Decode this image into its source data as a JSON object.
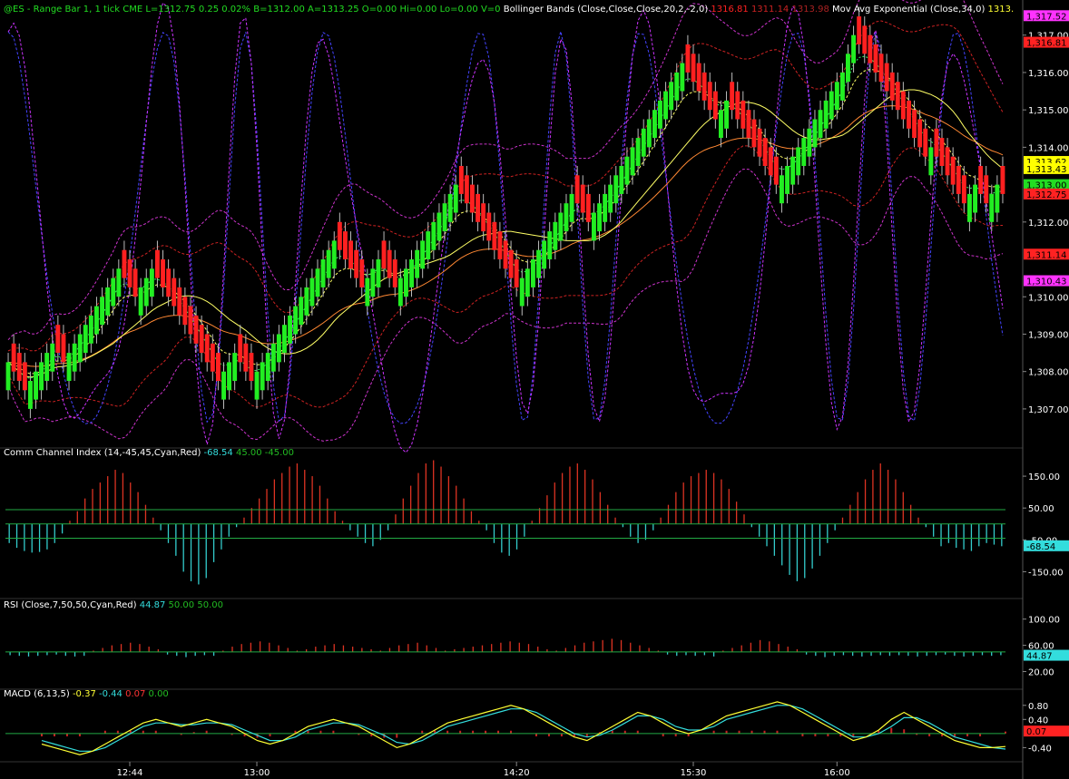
{
  "chart_data": [
    {
      "type": "candlestick",
      "title": "@ES - Range Bar 1, 1 tick  CME",
      "header_values": [
        "L=1312.75",
        "0.25",
        "0.02%",
        "B=1312.00",
        "A=1313.25",
        "O=0.00",
        "Hi=0.00",
        "Lo=0.00",
        "V=0"
      ],
      "indicators": [
        {
          "name": "Bollinger Bands (Close,Close,Close,20,2,-2,0)",
          "values": [
            "1316.81",
            "1311.14",
            "1313.98"
          ]
        },
        {
          "name": "Mov Avg Exponential (Close,34,0)",
          "values": [
            "1313."
          ]
        }
      ],
      "ylim": [
        1306.1,
        1317.6
      ],
      "y_ticks": [
        "1,317.00",
        "1,316.00",
        "1,315.00",
        "1,314.00",
        "1,312.00",
        "1,310.00",
        "1,309.00",
        "1,308.00",
        "1,307.00"
      ],
      "y_markers": [
        {
          "label": "1,317.52",
          "value": 1317.52,
          "color": "#ff33ff"
        },
        {
          "label": "1,316.81",
          "value": 1316.81,
          "color": "#ff2222"
        },
        {
          "label": "1,313.62",
          "value": 1313.62,
          "color": "#ffff00"
        },
        {
          "label": "1,313.43",
          "value": 1313.43,
          "color": "#ffff00"
        },
        {
          "label": "1,313.00",
          "value": 1313.0,
          "color": "#22dd22"
        },
        {
          "label": "1,312.75",
          "value": 1312.75,
          "color": "#ff2222"
        },
        {
          "label": "1,311.14",
          "value": 1311.14,
          "color": "#ff2222"
        },
        {
          "label": "1,310.43",
          "value": 1310.43,
          "color": "#ff33ff"
        }
      ],
      "closes": [
        1308.25,
        1308.0,
        1307.75,
        1307.5,
        1307.75,
        1308.0,
        1308.25,
        1308.5,
        1308.75,
        1308.5,
        1308.25,
        1308.5,
        1308.75,
        1309.0,
        1309.25,
        1309.5,
        1309.75,
        1310.0,
        1310.25,
        1310.5,
        1310.75,
        1310.5,
        1310.25,
        1310.0,
        1310.25,
        1310.5,
        1310.75,
        1310.5,
        1310.25,
        1310.0,
        1309.75,
        1309.5,
        1309.25,
        1309.0,
        1308.75,
        1308.5,
        1308.25,
        1308.0,
        1307.75,
        1308.0,
        1308.25,
        1308.5,
        1308.25,
        1308.0,
        1307.75,
        1308.0,
        1308.25,
        1308.5,
        1308.75,
        1309.0,
        1309.25,
        1309.5,
        1309.75,
        1310.0,
        1310.25,
        1310.5,
        1310.75,
        1311.0,
        1311.25,
        1311.5,
        1311.25,
        1311.0,
        1310.75,
        1310.5,
        1310.25,
        1310.5,
        1310.75,
        1311.0,
        1310.75,
        1310.5,
        1310.25,
        1310.5,
        1310.75,
        1311.0,
        1311.25,
        1311.5,
        1311.75,
        1312.0,
        1312.25,
        1312.5,
        1312.75,
        1313.0,
        1312.75,
        1312.5,
        1312.25,
        1312.0,
        1311.75,
        1311.5,
        1311.25,
        1311.0,
        1310.75,
        1310.5,
        1310.25,
        1310.5,
        1310.75,
        1311.0,
        1311.25,
        1311.5,
        1311.75,
        1312.0,
        1312.25,
        1312.5,
        1312.75,
        1312.5,
        1312.25,
        1312.0,
        1312.25,
        1312.5,
        1312.75,
        1313.0,
        1313.25,
        1313.5,
        1313.75,
        1314.0,
        1314.25,
        1314.5,
        1314.75,
        1315.0,
        1315.25,
        1315.5,
        1315.75,
        1316.0,
        1316.25,
        1316.0,
        1315.75,
        1315.5,
        1315.25,
        1315.0,
        1314.75,
        1315.0,
        1315.25,
        1315.0,
        1314.75,
        1314.5,
        1314.25,
        1314.0,
        1313.75,
        1313.5,
        1313.25,
        1313.0,
        1313.25,
        1313.5,
        1313.75,
        1314.0,
        1314.25,
        1314.5,
        1314.75,
        1315.0,
        1315.25,
        1315.5,
        1315.75,
        1316.0,
        1316.5,
        1317.0,
        1316.75,
        1316.5,
        1316.25,
        1316.0,
        1315.75,
        1315.5,
        1315.25,
        1315.0,
        1314.75,
        1314.5,
        1314.25,
        1314.0,
        1313.75,
        1314.0,
        1313.75,
        1313.5,
        1313.25,
        1313.0,
        1312.75,
        1312.5,
        1312.75,
        1313.0,
        1312.75,
        1312.5,
        1312.75,
        1313.0,
        1312.75
      ],
      "x_ticks": [
        "12:44",
        "13:00",
        "14:20",
        "15:30",
        "16:00"
      ],
      "x_tick_bars": [
        22,
        45,
        92,
        124,
        150
      ]
    },
    {
      "type": "bar",
      "title": "Comm Channel Index (14,-45,45,Cyan,Red)",
      "legend_values": [
        {
          "text": "-68.54",
          "color": "#33dddd"
        },
        {
          "text": "45.00",
          "color": "#22bb22"
        },
        {
          "text": "-45.00",
          "color": "#22bb22"
        }
      ],
      "ylim": [
        -220,
        210
      ],
      "y_ticks": [
        "150.00",
        "50.00",
        "-50.00",
        "-150.00"
      ],
      "last": "-68.54",
      "levels": [
        45,
        -45
      ],
      "values": [
        -60,
        -75,
        -85,
        -90,
        -88,
        -80,
        -60,
        -30,
        10,
        40,
        80,
        110,
        130,
        150,
        170,
        160,
        130,
        100,
        60,
        20,
        -20,
        -60,
        -100,
        -150,
        -180,
        -190,
        -170,
        -120,
        -80,
        -40,
        -10,
        20,
        50,
        80,
        110,
        140,
        160,
        180,
        190,
        170,
        150,
        120,
        80,
        40,
        10,
        -20,
        -40,
        -60,
        -70,
        -50,
        -20,
        30,
        80,
        120,
        160,
        190,
        200,
        180,
        150,
        120,
        80,
        40,
        10,
        -20,
        -60,
        -90,
        -100,
        -80,
        -40,
        10,
        50,
        90,
        130,
        160,
        180,
        190,
        170,
        140,
        100,
        60,
        20,
        -10,
        -40,
        -60,
        -50,
        -20,
        20,
        60,
        100,
        130,
        150,
        160,
        170,
        160,
        140,
        110,
        70,
        30,
        -10,
        -40,
        -70,
        -100,
        -130,
        -160,
        -180,
        -170,
        -140,
        -100,
        -60,
        -20,
        20,
        60,
        100,
        140,
        170,
        190,
        170,
        140,
        100,
        60,
        20,
        -10,
        -40,
        -70,
        -60,
        -75,
        -80,
        -85,
        -70,
        -60,
        -65,
        -70
      ]
    },
    {
      "type": "bar",
      "title": "RSI (Close,7,50,50,Cyan,Red)",
      "legend_values": [
        {
          "text": "44.87",
          "color": "#33dddd"
        },
        {
          "text": "50.00",
          "color": "#22bb22"
        },
        {
          "text": "50.00",
          "color": "#22bb22"
        }
      ],
      "ylim": [
        0,
        112
      ],
      "y_ticks": [
        "100.00",
        "60.00",
        "20.00"
      ],
      "last": "44.87",
      "levels": [
        50
      ],
      "values": [
        45,
        44,
        43,
        44,
        45,
        46,
        44,
        43,
        44,
        52,
        56,
        60,
        62,
        64,
        62,
        58,
        54,
        46,
        44,
        42,
        44,
        45,
        44,
        52,
        58,
        62,
        64,
        66,
        64,
        60,
        56,
        52,
        54,
        58,
        60,
        62,
        60,
        58,
        56,
        54,
        52,
        56,
        60,
        62,
        64,
        60,
        56,
        52,
        54,
        56,
        58,
        60,
        62,
        64,
        66,
        64,
        62,
        58,
        54,
        52,
        56,
        60,
        64,
        66,
        68,
        70,
        68,
        64,
        60,
        56,
        52,
        46,
        44,
        45,
        44,
        45,
        43,
        52,
        56,
        60,
        64,
        68,
        66,
        62,
        58,
        54,
        46,
        44,
        42,
        44,
        45,
        44,
        43,
        44,
        45,
        44,
        45,
        44,
        43,
        44,
        45,
        46,
        44,
        43,
        44,
        45,
        44,
        45
      ]
    },
    {
      "type": "line",
      "title": "MACD (6,13,5)",
      "legend_values": [
        {
          "text": "-0.37",
          "color": "#ffff33"
        },
        {
          "text": "-0.44",
          "color": "#33dddd"
        },
        {
          "text": "0.07",
          "color": "#ff3333"
        },
        {
          "text": "0.00",
          "color": "#22bb22"
        }
      ],
      "ylim": [
        -0.75,
        1.0
      ],
      "y_ticks": [
        "0.80",
        "0.40",
        "-0.40"
      ],
      "last": "0.07",
      "macd": [
        -0.3,
        -0.4,
        -0.5,
        -0.6,
        -0.5,
        -0.3,
        -0.1,
        0.1,
        0.3,
        0.4,
        0.3,
        0.2,
        0.3,
        0.4,
        0.3,
        0.2,
        0.0,
        -0.2,
        -0.3,
        -0.2,
        0.0,
        0.2,
        0.3,
        0.4,
        0.3,
        0.2,
        0.0,
        -0.2,
        -0.4,
        -0.3,
        -0.1,
        0.1,
        0.3,
        0.4,
        0.5,
        0.6,
        0.7,
        0.8,
        0.7,
        0.5,
        0.3,
        0.1,
        -0.1,
        -0.2,
        0.0,
        0.2,
        0.4,
        0.6,
        0.5,
        0.3,
        0.1,
        0.0,
        0.1,
        0.3,
        0.5,
        0.6,
        0.7,
        0.8,
        0.9,
        0.8,
        0.6,
        0.4,
        0.2,
        0.0,
        -0.2,
        -0.1,
        0.1,
        0.4,
        0.6,
        0.4,
        0.2,
        0.0,
        -0.2,
        -0.3,
        -0.4,
        -0.4,
        -0.37
      ],
      "signal": [
        -0.2,
        -0.3,
        -0.4,
        -0.5,
        -0.5,
        -0.4,
        -0.2,
        0.0,
        0.2,
        0.3,
        0.3,
        0.25,
        0.25,
        0.3,
        0.3,
        0.25,
        0.1,
        -0.05,
        -0.2,
        -0.2,
        -0.1,
        0.1,
        0.2,
        0.3,
        0.3,
        0.25,
        0.1,
        -0.05,
        -0.25,
        -0.3,
        -0.2,
        0.0,
        0.2,
        0.3,
        0.4,
        0.5,
        0.6,
        0.7,
        0.7,
        0.6,
        0.4,
        0.2,
        0.0,
        -0.1,
        -0.05,
        0.1,
        0.3,
        0.5,
        0.5,
        0.4,
        0.2,
        0.1,
        0.1,
        0.2,
        0.4,
        0.5,
        0.6,
        0.7,
        0.8,
        0.8,
        0.7,
        0.5,
        0.3,
        0.1,
        -0.1,
        -0.1,
        0.0,
        0.2,
        0.45,
        0.45,
        0.3,
        0.1,
        -0.1,
        -0.2,
        -0.3,
        -0.4,
        -0.44
      ]
    }
  ]
}
